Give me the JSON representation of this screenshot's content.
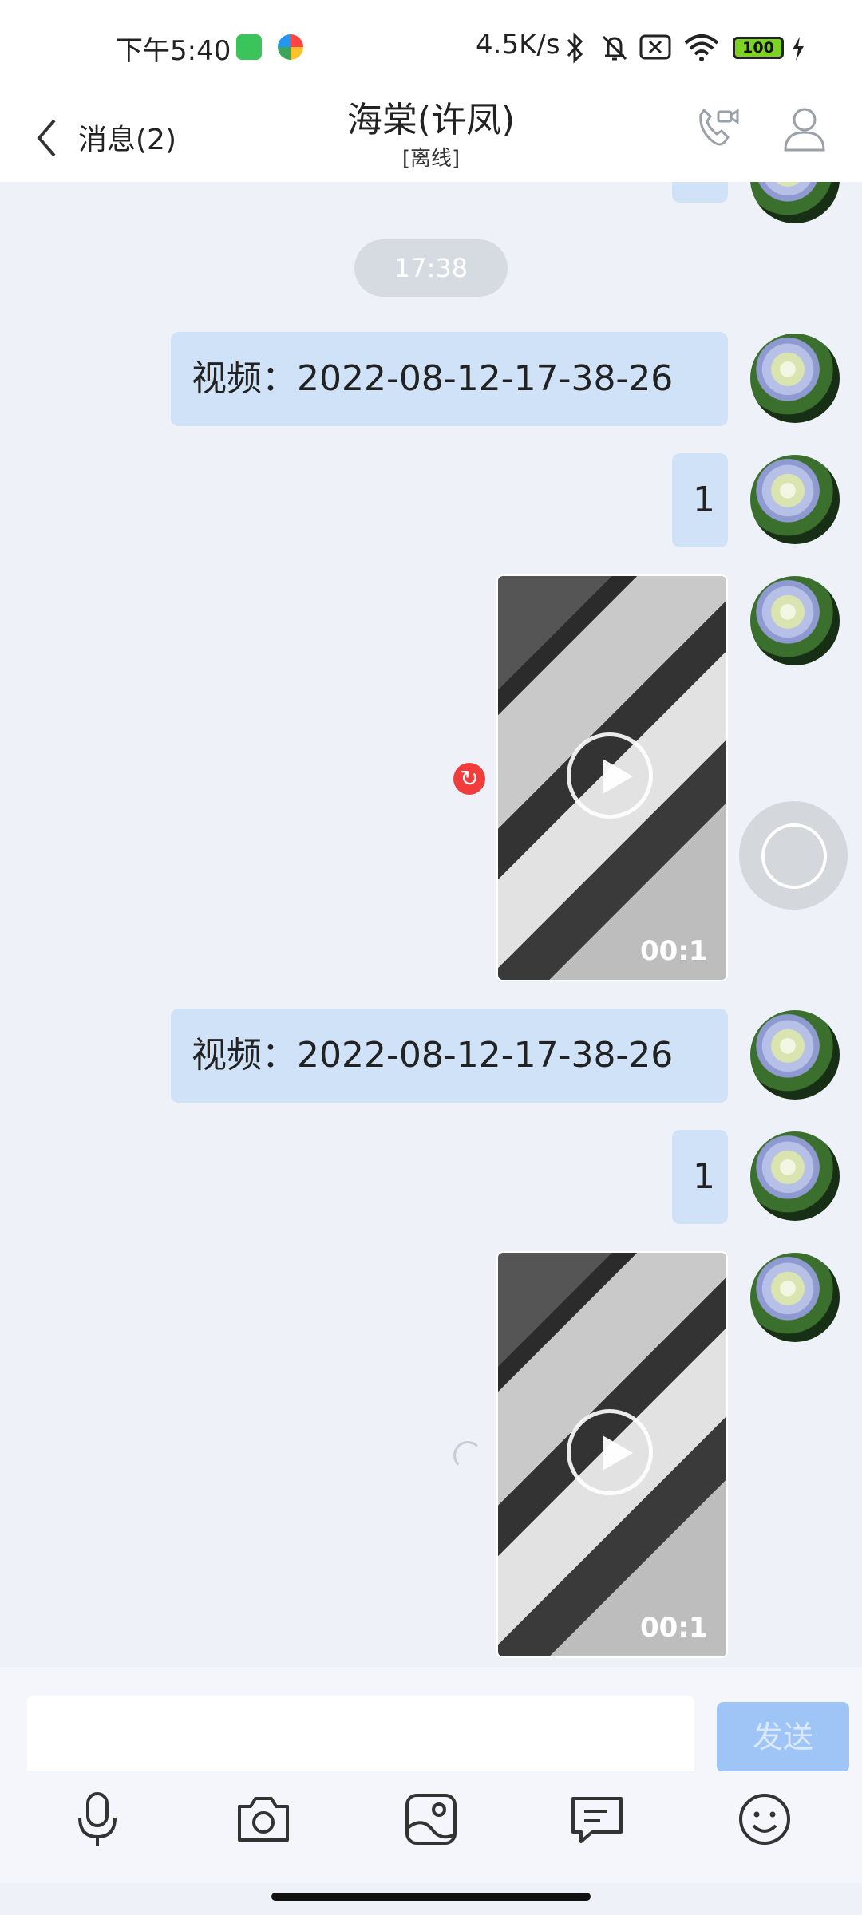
{
  "status_bar": {
    "time": "下午5:40",
    "net_speed": "4.5K/s",
    "battery": "100"
  },
  "header": {
    "back_label": "消息(2)",
    "title": "海棠(许凤)",
    "subtitle": "[离线]"
  },
  "chat": {
    "timestamp": "17:38",
    "messages": [
      {
        "type": "text",
        "text": "视频：2022-08-12-17-38-26"
      },
      {
        "type": "text",
        "text": "1"
      },
      {
        "type": "video",
        "duration": "00:1",
        "status": "failed"
      },
      {
        "type": "text",
        "text": "视频：2022-08-12-17-38-26"
      },
      {
        "type": "text",
        "text": "1"
      },
      {
        "type": "video",
        "duration": "00:1",
        "status": "sending"
      }
    ]
  },
  "input": {
    "placeholder": "",
    "send_label": "发送"
  },
  "toolbar": {
    "icons": [
      "microphone-icon",
      "camera-icon",
      "image-icon",
      "quick-reply-icon",
      "emoji-icon"
    ]
  },
  "colors": {
    "bubble": "#cfe2f8",
    "background": "#eef1f8",
    "send_button": "#9fc4f6",
    "error": "#f23b3b"
  }
}
